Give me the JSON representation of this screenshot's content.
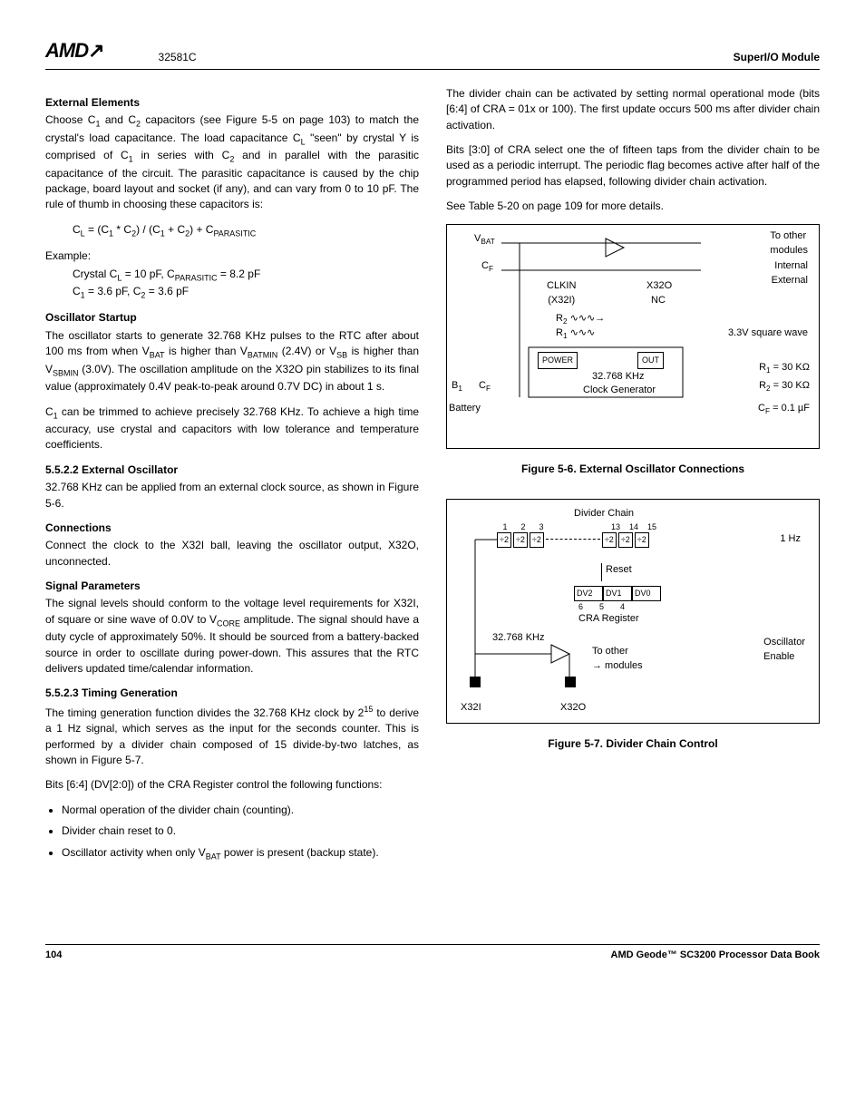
{
  "header": {
    "logo": "AMD",
    "docnum": "32581C",
    "module": "SuperI/O Module"
  },
  "left": {
    "h_external_elements": "External Elements",
    "p_ee1": "Choose C₁ and C₂ capacitors (see Figure 5-5 on page 103) to match the crystal's load capacitance. The load capacitance C_L \"seen\" by crystal Y is comprised of C₁ in series with C₂ and in parallel with the parasitic capacitance of the circuit. The parasitic capacitance is caused by the chip package, board layout and socket (if any), and can vary from 0 to 10 pF. The rule of thumb in choosing these capacitors is:",
    "formula": "C_L = (C₁ * C₂) / (C₁ + C₂) + C_PARASITIC",
    "example_label": "Example:",
    "example_l1": "Crystal C_L = 10 pF, C_PARASITIC = 8.2 pF",
    "example_l2": "C₁ = 3.6 pF, C₂ = 3.6 pF",
    "h_osc_startup": "Oscillator Startup",
    "p_os1": "The oscillator starts to generate 32.768 KHz pulses to the RTC after about 100 ms from when V_BAT is higher than V_BATMIN (2.4V) or V_SB is higher than V_SBMIN (3.0V). The oscillation amplitude on the X32O pin stabilizes to its final value (approximately 0.4V peak-to-peak around 0.7V DC) in about 1 s.",
    "p_os2": "C₁ can be trimmed to achieve precisely 32.768 KHz. To achieve a high time accuracy, use crystal and capacitors with low tolerance and temperature coefficients.",
    "h_ext_osc": "5.5.2.2    External Oscillator",
    "p_eo1": "32.768 KHz can be applied from an external clock source, as shown in Figure 5-6.",
    "h_connections": "Connections",
    "p_conn": "Connect the clock to the X32I ball, leaving the oscillator output, X32O, unconnected.",
    "h_sigparam": "Signal Parameters",
    "p_sig": "The signal levels should conform to the voltage level requirements for X32I, of square or sine wave of 0.0V to V_CORE amplitude. The signal should have a duty cycle of approximately 50%. It should be sourced from a battery-backed source in order to oscillate during power-down. This assures that the RTC delivers updated time/calendar information.",
    "h_timing": "5.5.2.3    Timing Generation",
    "p_tg1": "The timing generation function divides the 32.768 KHz clock by 2¹⁵ to derive a 1 Hz signal, which serves as the input for the seconds counter. This is performed by a divider chain composed of 15 divide-by-two latches, as shown in Figure 5-7.",
    "p_tg2": "Bits [6:4] (DV[2:0]) of the CRA Register control the following functions:",
    "bullets": [
      "Normal operation of the divider chain (counting).",
      "Divider chain reset to 0.",
      "Oscillator activity when only V_BAT power is present (backup state)."
    ]
  },
  "right": {
    "p_r1": "The divider chain can be activated by setting normal operational mode (bits [6:4] of CRA = 01x or 100). The first update occurs 500 ms after divider chain activation.",
    "p_r2": "Bits [3:0] of CRA select one the of fifteen taps from the divider chain to be used as a periodic interrupt. The periodic flag becomes active after half of the programmed period has elapsed, following divider chain activation.",
    "p_r3": "See Table 5-20 on page 109 for more details.",
    "fig6": {
      "vbat": "V_BAT",
      "to_other": "To other\nmodules",
      "internal": "Internal",
      "external": "External",
      "cf": "C_F",
      "clkin": "CLKIN\n(X32I)",
      "x32o": "X32O",
      "nc": "NC",
      "r2": "R₂",
      "r1": "R₁",
      "sqwave": "3.3V square wave",
      "power": "POWER",
      "out": "OUT",
      "freq": "32.768 KHz",
      "clkgen": "Clock Generator",
      "b1": "B₁",
      "battery": "Battery",
      "r1eq": "R₁ = 30 KΩ",
      "r2eq": "R₂ = 30 KΩ",
      "cfeq": "C_F = 0.1 µF"
    },
    "fig6_caption": "Figure 5-6.  External Oscillator Connections",
    "fig7": {
      "divider_chain": "Divider Chain",
      "nums_top": [
        "1",
        "2",
        "3",
        "13",
        "14",
        "15"
      ],
      "divboxes": [
        "÷2",
        "÷2",
        "÷2",
        "÷2",
        "÷2",
        "÷2"
      ],
      "onehz": "1 Hz",
      "reset": "Reset",
      "dv": [
        "DV2",
        "DV1",
        "DV0"
      ],
      "dv_nums": [
        "6",
        "5",
        "4"
      ],
      "cra": "CRA Register",
      "freq": "32.768 KHz",
      "to_other": "To other\nmodules",
      "osc_en": "Oscillator\nEnable",
      "x32i": "X32I",
      "x32o": "X32O"
    },
    "fig7_caption": "Figure 5-7.  Divider Chain Control"
  },
  "footer": {
    "page": "104",
    "book": "AMD Geode™ SC3200 Processor Data Book"
  }
}
